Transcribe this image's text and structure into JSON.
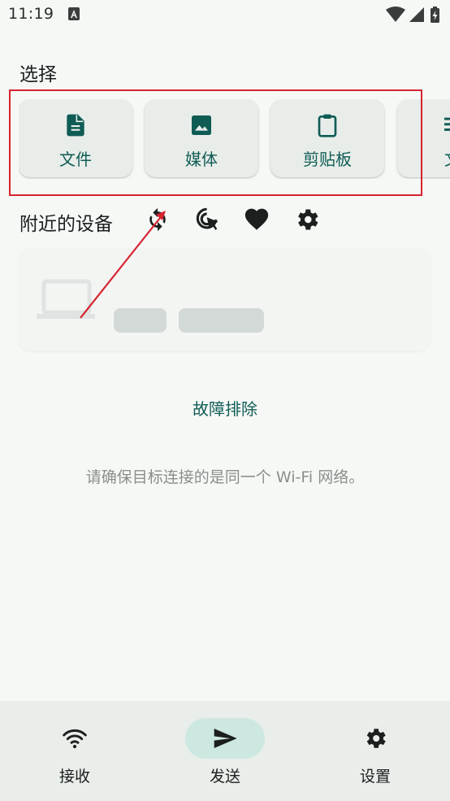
{
  "status_bar": {
    "time": "11:19"
  },
  "select_section": {
    "title": "选择",
    "tiles": [
      {
        "label": "文件",
        "icon": "file-document-icon"
      },
      {
        "label": "媒体",
        "icon": "image-icon"
      },
      {
        "label": "剪贴板",
        "icon": "clipboard-icon"
      },
      {
        "label": "文",
        "icon": "text-lines-icon"
      }
    ]
  },
  "nearby_section": {
    "title": "附近的设备",
    "actions": [
      "refresh-icon",
      "touch-target-icon",
      "heart-icon",
      "gear-icon"
    ]
  },
  "troubleshoot_label": "故障排除",
  "hint_text": "请确保目标连接的是同一个 Wi-Fi 网络。",
  "colors": {
    "accent": "#0f5c55",
    "highlight": "#d7232f",
    "nav_active": "#cde8e1"
  },
  "bottom_nav": [
    {
      "label": "接收",
      "icon": "wifi-icon",
      "active": false
    },
    {
      "label": "发送",
      "icon": "send-icon",
      "active": true
    },
    {
      "label": "设置",
      "icon": "gear-icon",
      "active": false
    }
  ]
}
